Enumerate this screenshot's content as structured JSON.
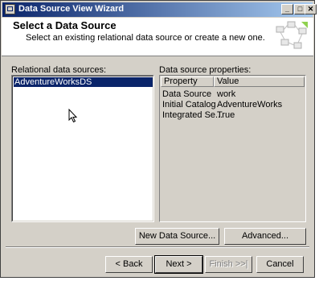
{
  "window": {
    "title": "Data Source View Wizard"
  },
  "caption_buttons": {
    "minimize": "_",
    "maximize": "□",
    "close": "✕"
  },
  "header": {
    "title": "Select a Data Source",
    "subtitle": "Select an existing relational data source or create a new one."
  },
  "relational": {
    "label": "Relational data sources:",
    "items": [
      "AdventureWorksDS"
    ],
    "selected_index": 0
  },
  "properties": {
    "label": "Data source properties:",
    "columns": [
      "Property",
      "Value"
    ],
    "rows": [
      {
        "property": "Data Source",
        "value": "work"
      },
      {
        "property": "Initial Catalog",
        "value": "AdventureWorks"
      },
      {
        "property": "Integrated Se...",
        "value": "True"
      }
    ]
  },
  "buttons": {
    "new_data_source": "New Data Source...",
    "advanced": "Advanced...",
    "back": "< Back",
    "next": "Next >",
    "finish": "Finish >>|",
    "cancel": "Cancel"
  },
  "colors": {
    "title_bar": "#0a246a",
    "selection": "#0a246a",
    "face": "#d4d0c8"
  },
  "icons": [
    "app-icon",
    "wizard-graphic-icon",
    "mouse-pointer-icon"
  ]
}
